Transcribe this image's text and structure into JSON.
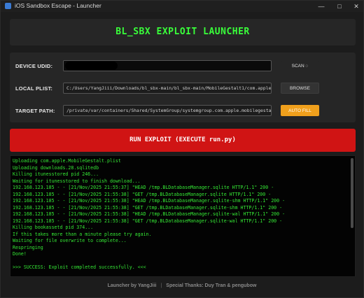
{
  "window": {
    "title": "iOS Sandbox Escape - Launcher",
    "controls": {
      "minimize": "—",
      "maximize": "□",
      "close": "✕"
    }
  },
  "header": {
    "title": "BL_SBX EXPLOIT LAUNCHER"
  },
  "form": {
    "device_udid": {
      "label": "DEVICE UDID:",
      "value": "",
      "button": "SCAN ◌"
    },
    "local_plist": {
      "label": "LOCAL PLIST:",
      "value": "C:/Users/YangJiii/Downloads/bl_sbx-main/bl_sbx-main/MobileGestalt1/com.apple.",
      "button": "BROWSE"
    },
    "target_path": {
      "label": "TARGET PATH:",
      "value": "/private/var/containers/Shared/SystemGroup/systemgroup.com.apple.mobilegestal",
      "button": "AUTO FILL"
    }
  },
  "run_button": {
    "label": "RUN EXPLOIT (EXECUTE run.py)"
  },
  "console": {
    "lines": [
      "Uploading com.apple.MobileGestalt.plist",
      "Uploading downloads.28.sqlitedb",
      "Killing itunesstored pid 246...",
      "Waiting for itunesstored to finish download...",
      "192.168.123.185 - - [21/Nov/2025 21:55:37] \"HEAD /tmp.BLDatabaseManager.sqlite HTTP/1.1\" 200 -",
      "192.168.123.185 - - [21/Nov/2025 21:55:38] \"GET /tmp.BLDatabaseManager.sqlite HTTP/1.1\" 200 -",
      "192.168.123.185 - - [21/Nov/2025 21:55:38] \"HEAD /tmp.BLDatabaseManager.sqlite-shm HTTP/1.1\" 200 -",
      "192.168.123.185 - - [21/Nov/2025 21:55:38] \"GET /tmp.BLDatabaseManager.sqlite-shm HTTP/1.1\" 200 -",
      "192.168.123.185 - - [21/Nov/2025 21:55:38] \"HEAD /tmp.BLDatabaseManager.sqlite-wal HTTP/1.1\" 200 -",
      "192.168.123.185 - - [21/Nov/2025 21:55:38] \"GET /tmp.BLDatabaseManager.sqlite-wal HTTP/1.1\" 200 -",
      "Killing bookassetd pid 374...",
      "If this takes more than a minute please try again.",
      "Waiting for file overwrite to complete...",
      "Respringing",
      "Done!",
      "",
      ">>> SUCCESS: Exploit completed successfully. <<<"
    ]
  },
  "footer": {
    "left": "Launcher by YangJiii",
    "separator": "|",
    "right": "Special Thanks: Duy Tran & pengubow"
  }
}
